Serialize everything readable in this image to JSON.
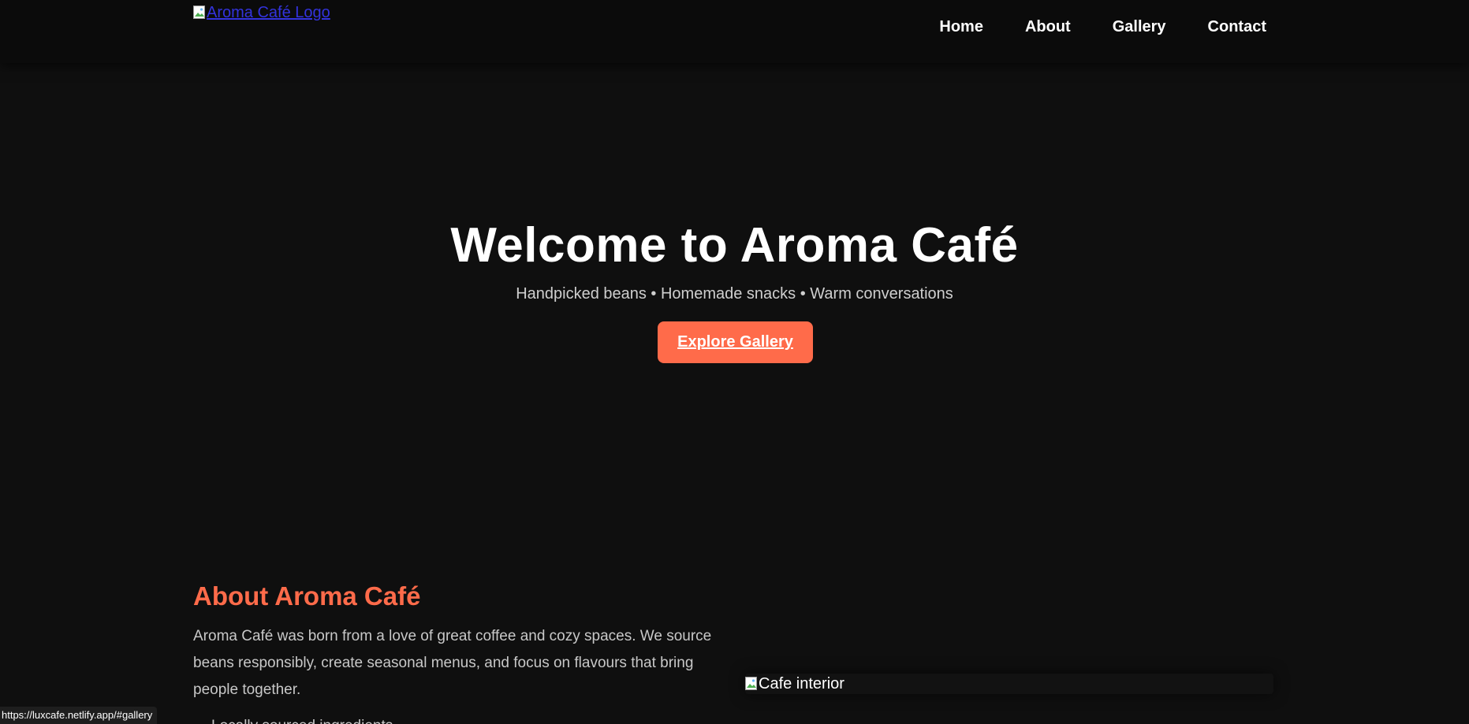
{
  "header": {
    "logo_alt": "Aroma Café Logo",
    "nav": [
      {
        "label": "Home"
      },
      {
        "label": "About"
      },
      {
        "label": "Gallery"
      },
      {
        "label": "Contact"
      }
    ]
  },
  "hero": {
    "title": "Welcome to Aroma Café",
    "subtitle": "Handpicked beans • Homemade snacks • Warm conversations",
    "cta_label": "Explore Gallery"
  },
  "about": {
    "title": "About Aroma Café",
    "text": "Aroma Café was born from a love of great coffee and cozy spaces. We source beans responsibly, create seasonal menus, and focus on flavours that bring people together.",
    "list": [
      "Locally sourced ingredients"
    ],
    "image_alt": "Cafe interior"
  },
  "status_bar": {
    "url": "https://luxcafe.netlify.app/#gallery"
  },
  "colors": {
    "background": "#0f0f0f",
    "accent": "#ff6b4a",
    "header": "#0b0b0b"
  }
}
